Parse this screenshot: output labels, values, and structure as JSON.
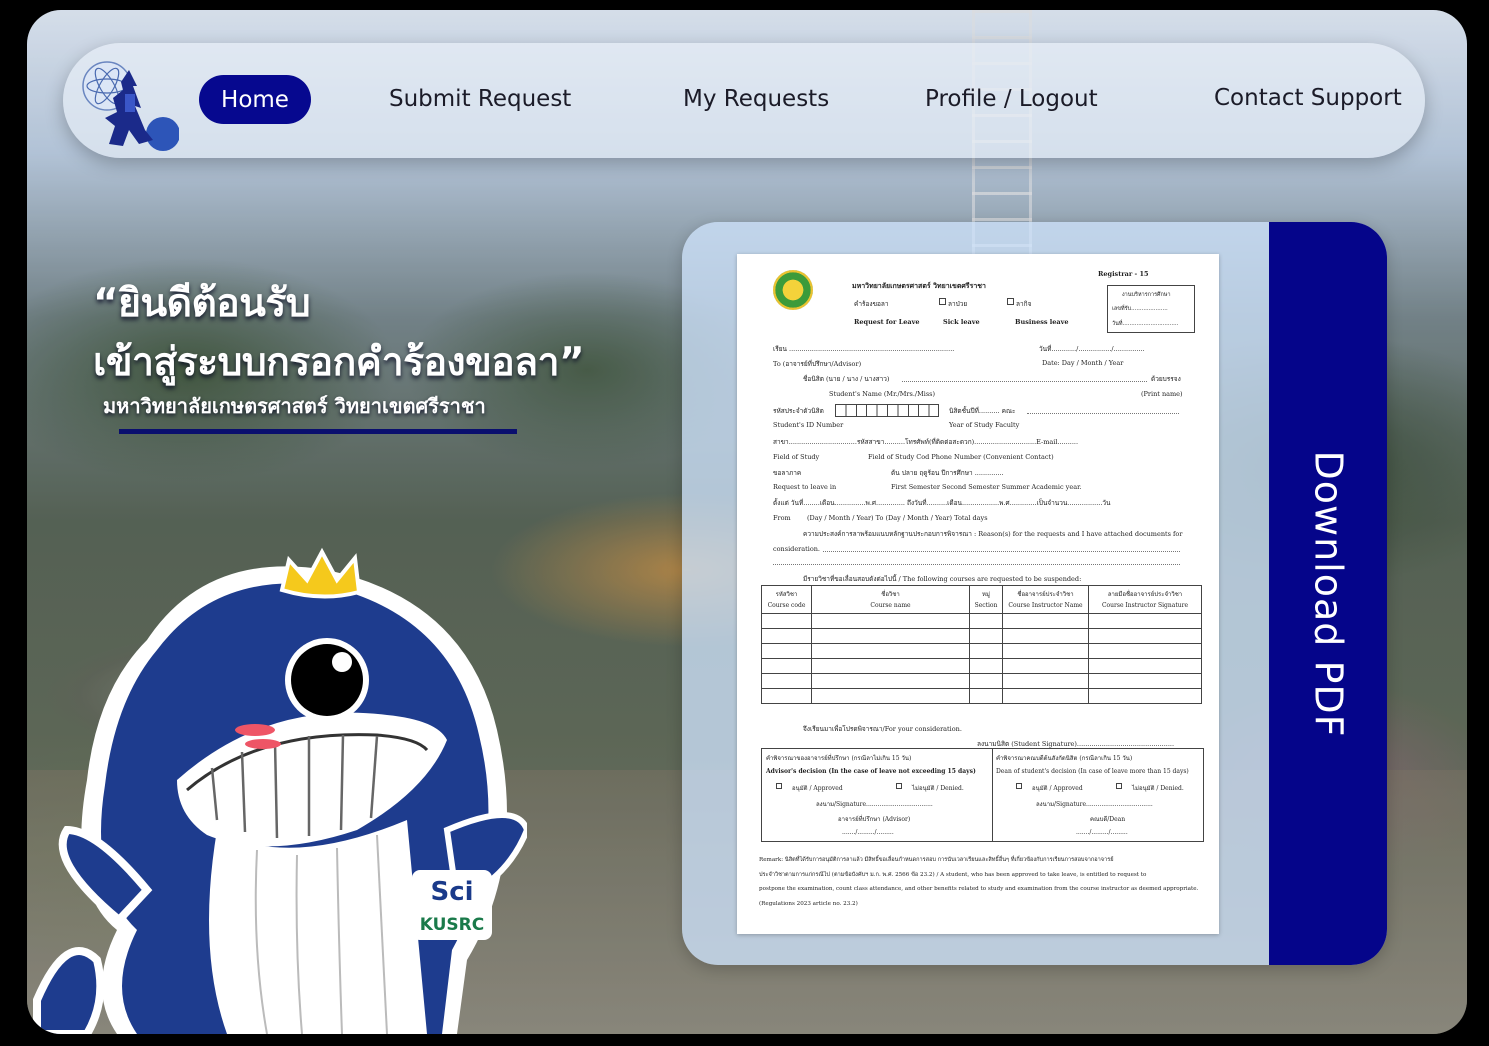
{
  "nav": {
    "items": [
      {
        "label": "Home",
        "active": true
      },
      {
        "label": "Submit Request"
      },
      {
        "label": "My Requests"
      },
      {
        "label": "Profile / Logout"
      },
      {
        "label": "Contact Support"
      }
    ]
  },
  "hero": {
    "line1": "“ยินดีต้อนรับ",
    "line2": "เข้าสู่ระบบกรอกคำร้องขอลา”",
    "subtitle": "มหาวิทยาลัยเกษตรศาสตร์ วิทยาเขตศรีราชา"
  },
  "mascot": {
    "badge_top": "Sci",
    "badge_bottom": "KUSRC"
  },
  "card": {
    "download_label": "Download PDF",
    "form": {
      "code": "Registrar - 15",
      "university": "มหาวิทยาลัยเกษตรศาสตร์ วิทยาเขตศรีราชา",
      "req_th": "คำร้องขอลา",
      "sick_th": "ลาป่วย",
      "business_th": "ลากิจ",
      "req_en": "Request for Leave",
      "sick_en": "Sick leave",
      "business_en": "Business leave",
      "office_box": [
        "งานบริหารการศึกษา",
        "เลขที่รับ.....................",
        "วันที่................................"
      ],
      "lines": [
        "เรียน ................................................................................",
        "To (อาจารย์ที่ปรึกษา/Advisor)",
        "ชื่อนิสิต (นาย / นาง / นางสาว)",
        "Student's Name (Mr./Mrs./Miss)",
        "รหัสประจำตัวนิสิต",
        "Student's ID Number",
        "สาขา.................................รหัสสาขา..........โทรศัพท์(ที่ติดต่อสะดวก)..............................E-mail..........",
        "Field of Study",
        "ขอลาภาค",
        "Request to leave in",
        "ตั้งแต่ วันที่........เดือน...............พ.ศ.............. ถึงวันที่..........เดือน..................พ.ศ.............เป็นจำนวน.................วัน",
        "From",
        "ความประสงค์การลาพร้อมแนบหลักฐานประกอบการพิจารณา : Reason(s) for the requests and I have attached documents for",
        "consideration.",
        "มีรายวิชาที่ขอเลื่อนสอบดังต่อไปนี้ / The following courses are requested to be suspended:"
      ],
      "date_label": "วันที่............/................/...............",
      "date_en": "Date:     Day /      Month   /    Year",
      "print_name": "(Print name)",
      "name_suffix": "ด้วยบรรจง",
      "year_faculty_th": "นิสิตชั้นปีที่..........  คณะ",
      "year_faculty_en": "Year of Study        Faculty",
      "field_labels_en": "Field of Study Cod          Phone Number (Convenient Contact)",
      "semester_th": "ต้น                ปลาย              ฤดูร้อน        ปีการศึกษา ..............",
      "semester_en": "First Semester          Second Semester        Summer            Academic year.",
      "from_to_en": "(Day /  Month / Year)                 To          (Day /  Month / Year)                     Total                             days",
      "table_headers": [
        [
          "รหัสวิชา",
          "Course code"
        ],
        [
          "ชื่อวิชา",
          "Course name"
        ],
        [
          "หมู่",
          "Section"
        ],
        [
          "ชื่ออาจารย์ประจำวิชา",
          "Course Instructor Name"
        ],
        [
          "ลายมือชื่ออาจารย์ประจำวิชา",
          "Course Instructor Signature"
        ]
      ],
      "consideration": "จึงเรียนมาเพื่อโปรดพิจารณา/For your consideration.",
      "student_sig": "ลงนามนิสิต (Student Signature)...............................................",
      "advisor_title_th": "คำพิจารณาของอาจารย์ที่ปรึกษา (กรณีลาไม่เกิน 15 วัน)",
      "advisor_title_en": "Advisor's decision (In the case of leave not exceeding 15 days)",
      "dean_title_th": "คำพิจารณาคณบดีต้นสังกัดนิสิต (กรณีลาเกิน 15 วัน)",
      "dean_title_en": "Dean of student's decision (In case of leave more than 15 days)",
      "approve": "อนุมัติ / Approved",
      "deny": "ไม่อนุมัติ / Denied.",
      "signature": "ลงนาม/Signature...................................",
      "advisor_role": "อาจารย์ที่ปรึกษา (Advisor)",
      "dean_role": "คณบดี/Dean",
      "date_blank": "......./........./.........",
      "remark": [
        "Remark: นิสิตที่ได้รับการอนุมัติการลาแล้ว มีสิทธิ์ขอเลื่อนกำหนดการสอบ การนับเวลาเรียนและสิทธิ์อื่นๆ ที่เกี่ยวข้องกับการเรียนการสอบจากอาจารย์",
        "ประจำวิชาตามการแก่กรณีไป (ตามข้อบังคับฯ ม.ก. พ.ศ. 2566 ข้อ 23.2) / A student, who has been approved to take leave, is entitled to request to",
        "postpone the examination, count class attendance, and other benefits related to study and examination from the course instructor as deemed appropriate.",
        "(Regulations 2023 article no. 23.2)"
      ]
    }
  }
}
